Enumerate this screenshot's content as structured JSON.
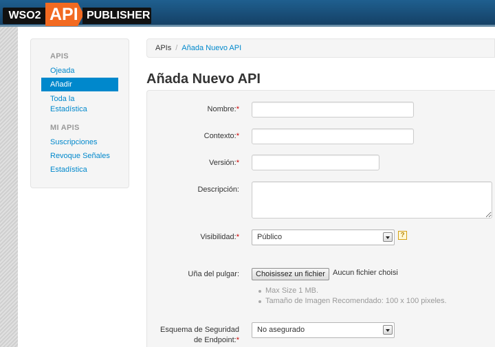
{
  "header": {
    "logo_left": "WSO2",
    "logo_mid": "API",
    "logo_right": "PUBLISHER"
  },
  "sidebar": {
    "section1": "APIS",
    "items1": [
      "Ojeada",
      "Añadir",
      "Toda la",
      "Estadística"
    ],
    "section2": "MI APIS",
    "items2": [
      "Suscripciones",
      "Revoque Señales",
      "Estadística"
    ]
  },
  "breadcrumb": {
    "home": "APIs",
    "separator": "/",
    "current": "Añada Nuevo API"
  },
  "title": "Añada Nuevo API",
  "form": {
    "required_mark": "*",
    "name_label": "Nombre:",
    "name_value": "",
    "context_label": "Contexto:",
    "context_value": "",
    "version_label": "Versión:",
    "version_value": "",
    "description_label": "Descripción:",
    "description_value": "",
    "visibility_label": "Visibilidad:",
    "visibility_value": "Público",
    "help_glyph": "?",
    "thumbnail_label": "Uña del pulgar:",
    "file_button": "Choisissez un fichier",
    "file_status": "Aucun fichier choisi",
    "hints": [
      "Max Size 1 MB.",
      "Tamaño de Imagen Recomendado: 100 x 100 pixeles."
    ],
    "security_label_line1": "Esquema de Seguridad",
    "security_label_line2": "de Endpoint:",
    "security_value": "No asegurado"
  },
  "icons": {
    "select_arrow": "chevron-down-icon",
    "help": "help-icon"
  }
}
